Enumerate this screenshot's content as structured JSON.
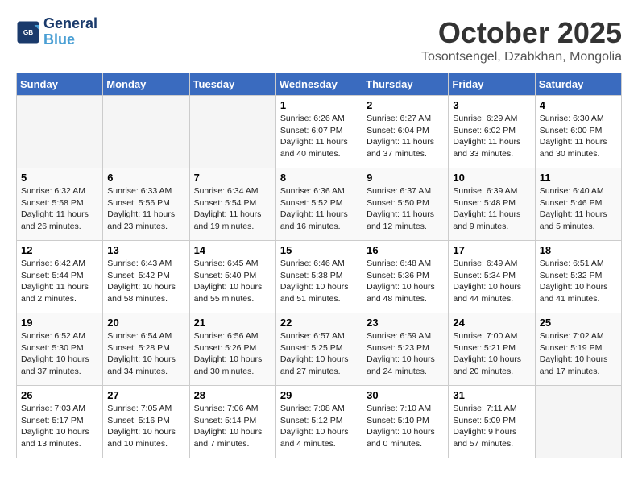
{
  "logo": {
    "line1": "General",
    "line2": "Blue"
  },
  "title": "October 2025",
  "location": "Tosontsengel, Dzabkhan, Mongolia",
  "weekdays": [
    "Sunday",
    "Monday",
    "Tuesday",
    "Wednesday",
    "Thursday",
    "Friday",
    "Saturday"
  ],
  "weeks": [
    [
      {
        "day": "",
        "info": ""
      },
      {
        "day": "",
        "info": ""
      },
      {
        "day": "",
        "info": ""
      },
      {
        "day": "1",
        "info": "Sunrise: 6:26 AM\nSunset: 6:07 PM\nDaylight: 11 hours\nand 40 minutes."
      },
      {
        "day": "2",
        "info": "Sunrise: 6:27 AM\nSunset: 6:04 PM\nDaylight: 11 hours\nand 37 minutes."
      },
      {
        "day": "3",
        "info": "Sunrise: 6:29 AM\nSunset: 6:02 PM\nDaylight: 11 hours\nand 33 minutes."
      },
      {
        "day": "4",
        "info": "Sunrise: 6:30 AM\nSunset: 6:00 PM\nDaylight: 11 hours\nand 30 minutes."
      }
    ],
    [
      {
        "day": "5",
        "info": "Sunrise: 6:32 AM\nSunset: 5:58 PM\nDaylight: 11 hours\nand 26 minutes."
      },
      {
        "day": "6",
        "info": "Sunrise: 6:33 AM\nSunset: 5:56 PM\nDaylight: 11 hours\nand 23 minutes."
      },
      {
        "day": "7",
        "info": "Sunrise: 6:34 AM\nSunset: 5:54 PM\nDaylight: 11 hours\nand 19 minutes."
      },
      {
        "day": "8",
        "info": "Sunrise: 6:36 AM\nSunset: 5:52 PM\nDaylight: 11 hours\nand 16 minutes."
      },
      {
        "day": "9",
        "info": "Sunrise: 6:37 AM\nSunset: 5:50 PM\nDaylight: 11 hours\nand 12 minutes."
      },
      {
        "day": "10",
        "info": "Sunrise: 6:39 AM\nSunset: 5:48 PM\nDaylight: 11 hours\nand 9 minutes."
      },
      {
        "day": "11",
        "info": "Sunrise: 6:40 AM\nSunset: 5:46 PM\nDaylight: 11 hours\nand 5 minutes."
      }
    ],
    [
      {
        "day": "12",
        "info": "Sunrise: 6:42 AM\nSunset: 5:44 PM\nDaylight: 11 hours\nand 2 minutes."
      },
      {
        "day": "13",
        "info": "Sunrise: 6:43 AM\nSunset: 5:42 PM\nDaylight: 10 hours\nand 58 minutes."
      },
      {
        "day": "14",
        "info": "Sunrise: 6:45 AM\nSunset: 5:40 PM\nDaylight: 10 hours\nand 55 minutes."
      },
      {
        "day": "15",
        "info": "Sunrise: 6:46 AM\nSunset: 5:38 PM\nDaylight: 10 hours\nand 51 minutes."
      },
      {
        "day": "16",
        "info": "Sunrise: 6:48 AM\nSunset: 5:36 PM\nDaylight: 10 hours\nand 48 minutes."
      },
      {
        "day": "17",
        "info": "Sunrise: 6:49 AM\nSunset: 5:34 PM\nDaylight: 10 hours\nand 44 minutes."
      },
      {
        "day": "18",
        "info": "Sunrise: 6:51 AM\nSunset: 5:32 PM\nDaylight: 10 hours\nand 41 minutes."
      }
    ],
    [
      {
        "day": "19",
        "info": "Sunrise: 6:52 AM\nSunset: 5:30 PM\nDaylight: 10 hours\nand 37 minutes."
      },
      {
        "day": "20",
        "info": "Sunrise: 6:54 AM\nSunset: 5:28 PM\nDaylight: 10 hours\nand 34 minutes."
      },
      {
        "day": "21",
        "info": "Sunrise: 6:56 AM\nSunset: 5:26 PM\nDaylight: 10 hours\nand 30 minutes."
      },
      {
        "day": "22",
        "info": "Sunrise: 6:57 AM\nSunset: 5:25 PM\nDaylight: 10 hours\nand 27 minutes."
      },
      {
        "day": "23",
        "info": "Sunrise: 6:59 AM\nSunset: 5:23 PM\nDaylight: 10 hours\nand 24 minutes."
      },
      {
        "day": "24",
        "info": "Sunrise: 7:00 AM\nSunset: 5:21 PM\nDaylight: 10 hours\nand 20 minutes."
      },
      {
        "day": "25",
        "info": "Sunrise: 7:02 AM\nSunset: 5:19 PM\nDaylight: 10 hours\nand 17 minutes."
      }
    ],
    [
      {
        "day": "26",
        "info": "Sunrise: 7:03 AM\nSunset: 5:17 PM\nDaylight: 10 hours\nand 13 minutes."
      },
      {
        "day": "27",
        "info": "Sunrise: 7:05 AM\nSunset: 5:16 PM\nDaylight: 10 hours\nand 10 minutes."
      },
      {
        "day": "28",
        "info": "Sunrise: 7:06 AM\nSunset: 5:14 PM\nDaylight: 10 hours\nand 7 minutes."
      },
      {
        "day": "29",
        "info": "Sunrise: 7:08 AM\nSunset: 5:12 PM\nDaylight: 10 hours\nand 4 minutes."
      },
      {
        "day": "30",
        "info": "Sunrise: 7:10 AM\nSunset: 5:10 PM\nDaylight: 10 hours\nand 0 minutes."
      },
      {
        "day": "31",
        "info": "Sunrise: 7:11 AM\nSunset: 5:09 PM\nDaylight: 9 hours\nand 57 minutes."
      },
      {
        "day": "",
        "info": ""
      }
    ]
  ]
}
